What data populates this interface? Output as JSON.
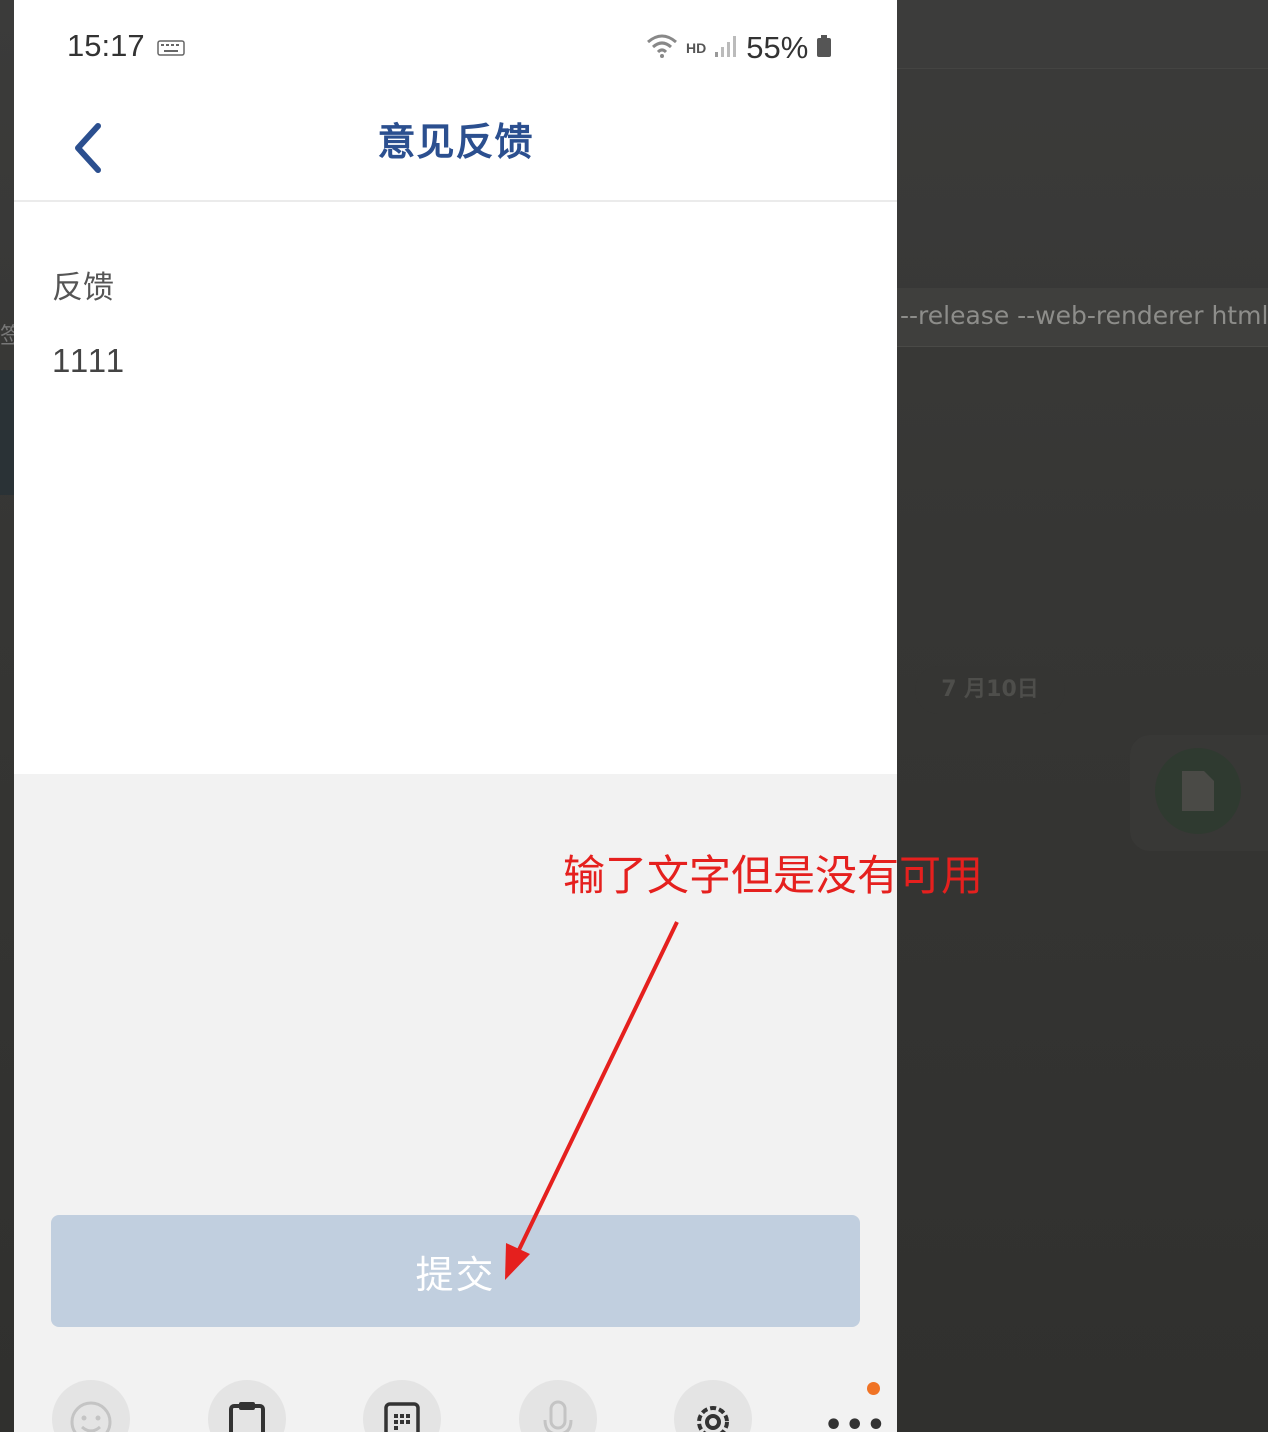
{
  "background": {
    "command_text": "--release --web-renderer html",
    "date_label": "7 月10日",
    "left_glyph": "签"
  },
  "status_bar": {
    "time": "15:17",
    "network": "HD",
    "battery": "55%"
  },
  "nav": {
    "back_icon": "chevron-left-icon",
    "title": "意见反馈"
  },
  "form": {
    "label": "反馈",
    "value": "1111"
  },
  "submit": {
    "label": "提交",
    "state": "disabled"
  },
  "keyboard_toolbar": {
    "icons": [
      "emoji-icon",
      "clipboard-icon",
      "keypad-icon",
      "microphone-icon",
      "settings-icon",
      "more-icon"
    ]
  },
  "annotation": {
    "text": "输了文字但是没有可用",
    "color": "#e5201e"
  },
  "colors": {
    "title": "#2b4f8f",
    "submit_bg": "#c1cfdf",
    "badge": "#f07325"
  }
}
